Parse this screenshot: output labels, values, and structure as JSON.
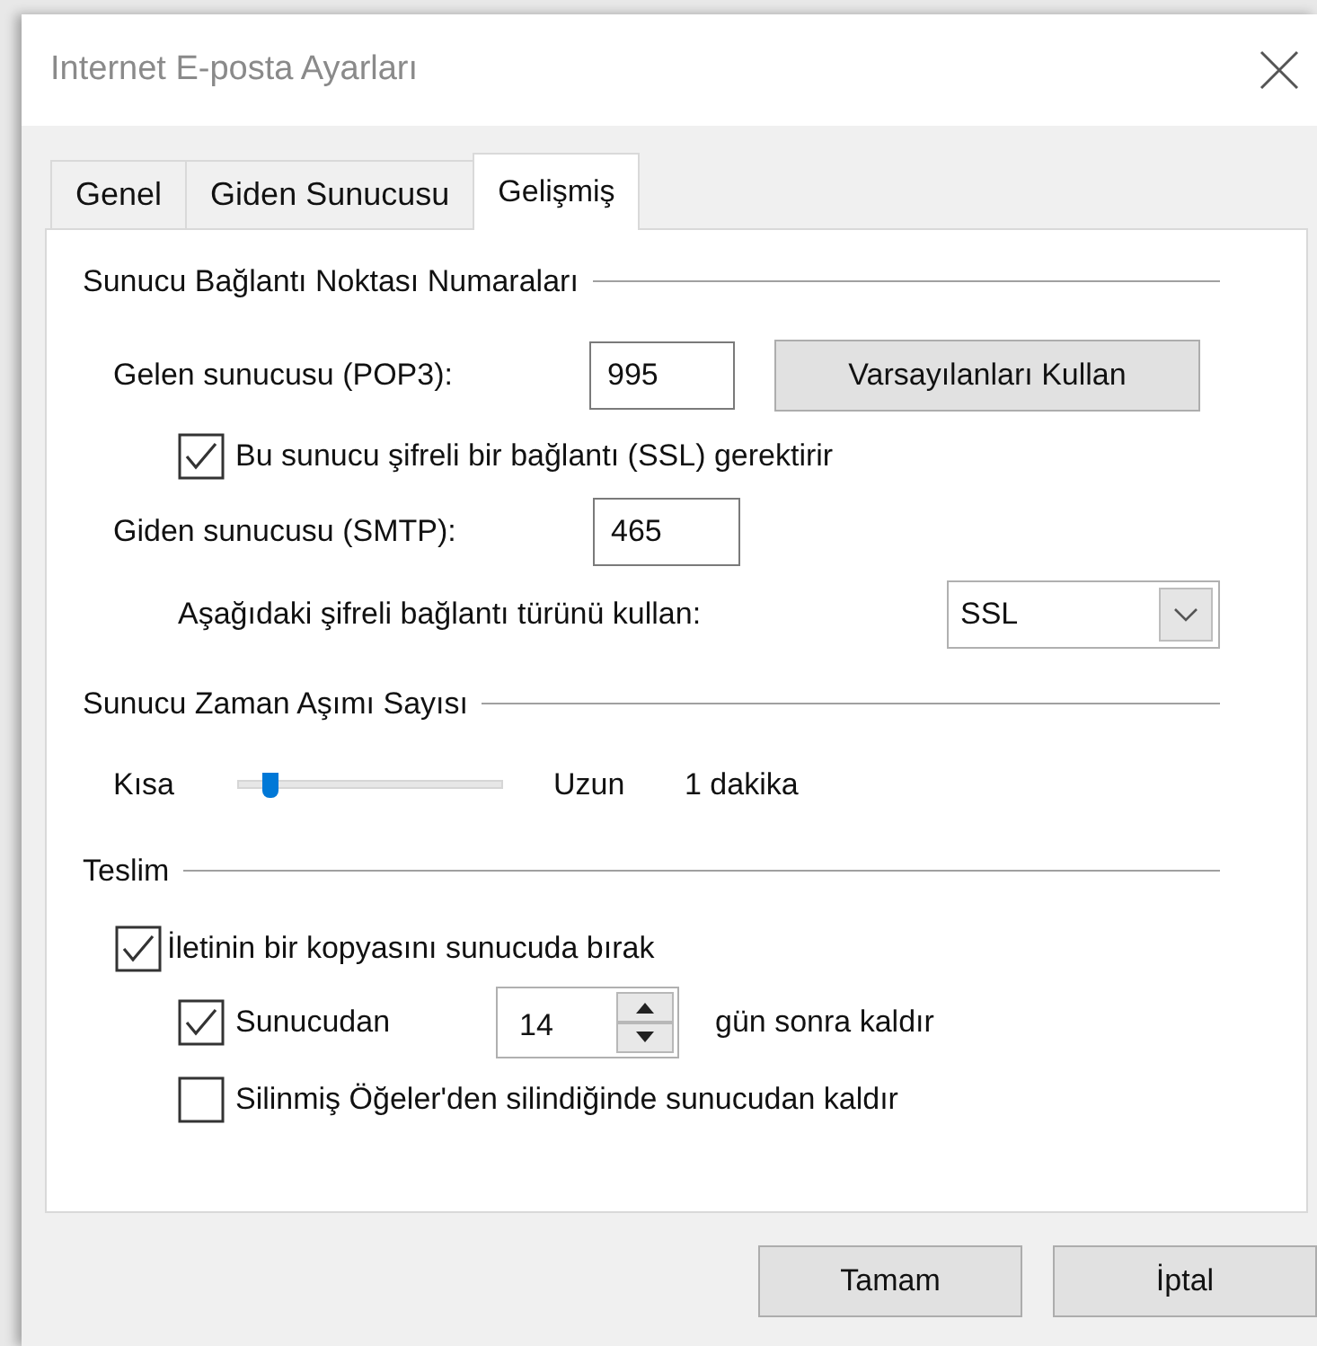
{
  "window": {
    "title": "Internet E-posta Ayarları"
  },
  "tabs": [
    {
      "label": "Genel",
      "selected": false
    },
    {
      "label": "Giden Sunucusu",
      "selected": false
    },
    {
      "label": "Gelişmiş",
      "selected": true
    }
  ],
  "port_numbers": {
    "heading": "Sunucu Bağlantı Noktası Numaraları",
    "incoming": {
      "label": "Gelen sunucusu (POP3):",
      "value": "995"
    },
    "defaults_button": "Varsayılanları Kullan",
    "ssl_required": {
      "label": "Bu sunucu şifreli bir bağlantı (SSL) gerektirir",
      "checked": true
    },
    "outgoing": {
      "label": "Giden sunucusu (SMTP):",
      "value": "465"
    },
    "encryption": {
      "label": "Aşağıdaki şifreli bağlantı türünü kullan:",
      "value": "SSL"
    }
  },
  "timeout": {
    "heading": "Sunucu Zaman Aşımı Sayısı",
    "short_label": "Kısa",
    "level": 0.1,
    "long_label": "Uzun",
    "value": "1 dakika"
  },
  "delivery": {
    "heading": "Teslim",
    "leave_copy": {
      "label": "İletinin bir kopyasını sunucuda bırak",
      "checked": true
    },
    "remove_after": {
      "label": "Sunucudan",
      "checked": true,
      "days": "14",
      "suffix": "gün sonra kaldır"
    },
    "remove_deleted": {
      "label": "Silinmiş Öğeler'den silindiğinde sunucudan kaldır",
      "checked": false
    }
  },
  "buttons": [
    {
      "label": "Tamam"
    },
    {
      "label": "İptal"
    }
  ]
}
